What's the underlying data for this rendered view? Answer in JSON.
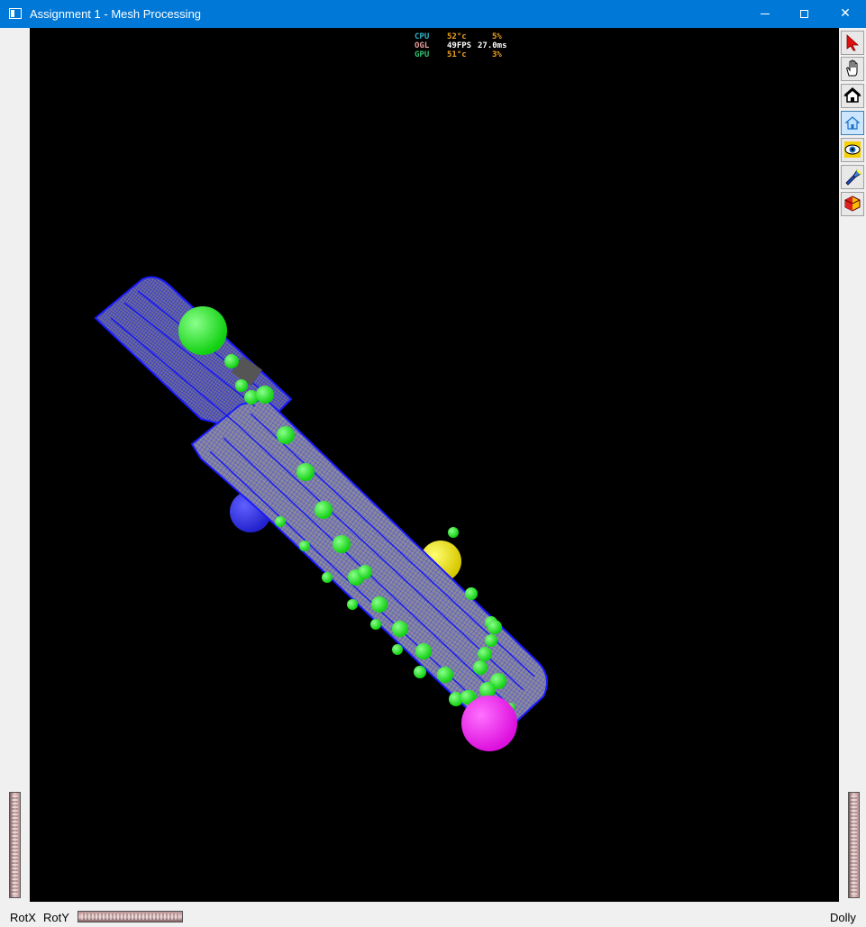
{
  "window": {
    "title": "Assignment 1 - Mesh Processing",
    "controls": [
      "minimize",
      "maximize",
      "close"
    ]
  },
  "overlay": {
    "rows": [
      {
        "label": "CPU",
        "label_color": "#2fb3c8",
        "value1": "52°c",
        "value2": "5%",
        "extra": ""
      },
      {
        "label": "OGL",
        "label_color": "#e8a0a0",
        "value1": "49FPS",
        "value2": "",
        "extra": "27.0ms"
      },
      {
        "label": "GPU",
        "label_color": "#30c070",
        "value1": "51°c",
        "value2": "3%",
        "extra": ""
      }
    ]
  },
  "toolbar": {
    "tools": [
      {
        "name": "select-arrow",
        "icon": "arrow-cursor-icon",
        "active": false
      },
      {
        "name": "pan-hand",
        "icon": "hand-icon",
        "active": false
      },
      {
        "name": "home-view",
        "icon": "home-icon",
        "active": false
      },
      {
        "name": "home-view-alt",
        "icon": "house-outline-icon",
        "active": true
      },
      {
        "name": "look-at",
        "icon": "eye-icon",
        "active": false
      },
      {
        "name": "light",
        "icon": "flashlight-icon",
        "active": false
      },
      {
        "name": "shading",
        "icon": "cube-icon",
        "active": false
      }
    ]
  },
  "bottom": {
    "rotx_label": "RotX",
    "roty_label": "RotY",
    "dolly_label": "Dolly"
  },
  "colors": {
    "titlebar": "#0078d7",
    "mesh_wire": "#1a1aff",
    "mesh_fill": "#8a8a8a",
    "markers": "#2ef12e",
    "sphere_green": "#2ef12e",
    "sphere_blue": "#3333ee",
    "sphere_yellow": "#f2e81a",
    "sphere_magenta": "#ee22ee"
  }
}
